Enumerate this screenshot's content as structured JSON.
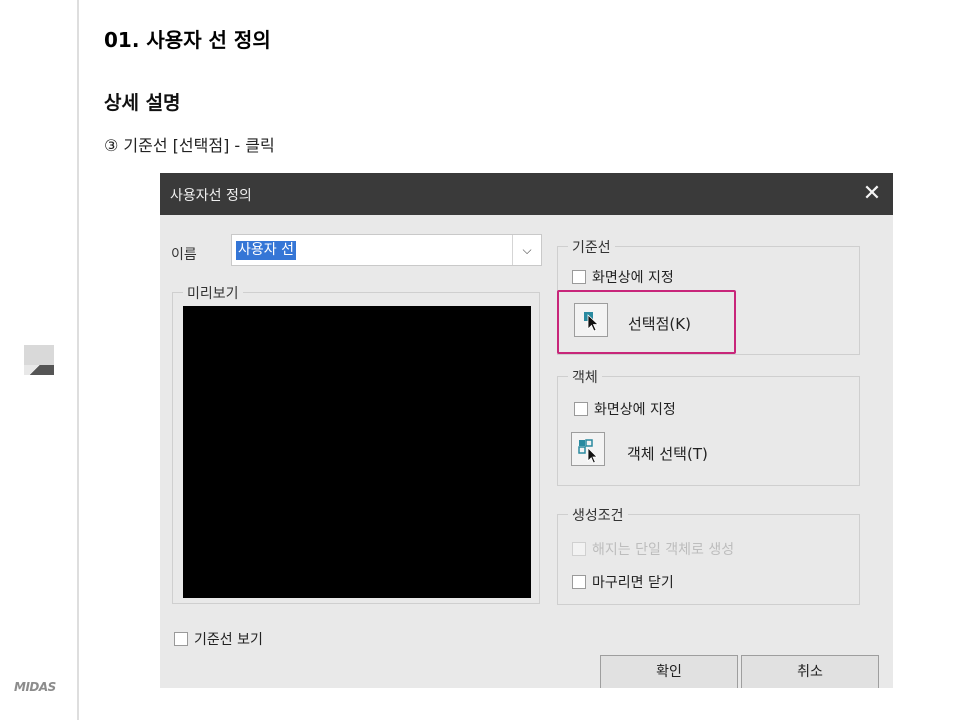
{
  "doc": {
    "heading": "01. 사용자 선 정의",
    "subheading": "상세 설명",
    "step": "③ 기준선 [선택점] - 클릭"
  },
  "sidebar": {
    "logo": "MIDAS"
  },
  "dialog": {
    "title": "사용자선 정의",
    "close_glyph": "✕",
    "name_label": "이름",
    "name_value": "사용자 선",
    "preview_label": "미리보기",
    "reference": {
      "legend": "기준선",
      "on_screen_label": "화면상에 지정",
      "on_screen_checked": false,
      "select_point_label": "선택점(K)"
    },
    "object": {
      "legend": "객체",
      "on_screen_label": "화면상에 지정",
      "on_screen_checked": false,
      "select_object_label": "객체 선택(T)"
    },
    "conditions": {
      "legend": "생성조건",
      "single_object_label": "해지는 단일 객체로 생성",
      "single_object_enabled": false,
      "close_on_finish_label": "마구리면 닫기",
      "close_on_finish_checked": false
    },
    "show_baseline_label": "기준선 보기",
    "ok_label": "확인",
    "cancel_label": "취소"
  },
  "colors": {
    "titlebar": "#3a3a3a",
    "highlight": "#c8267a",
    "selection": "#3576d6",
    "icon_teal": "#2a8aa0"
  }
}
